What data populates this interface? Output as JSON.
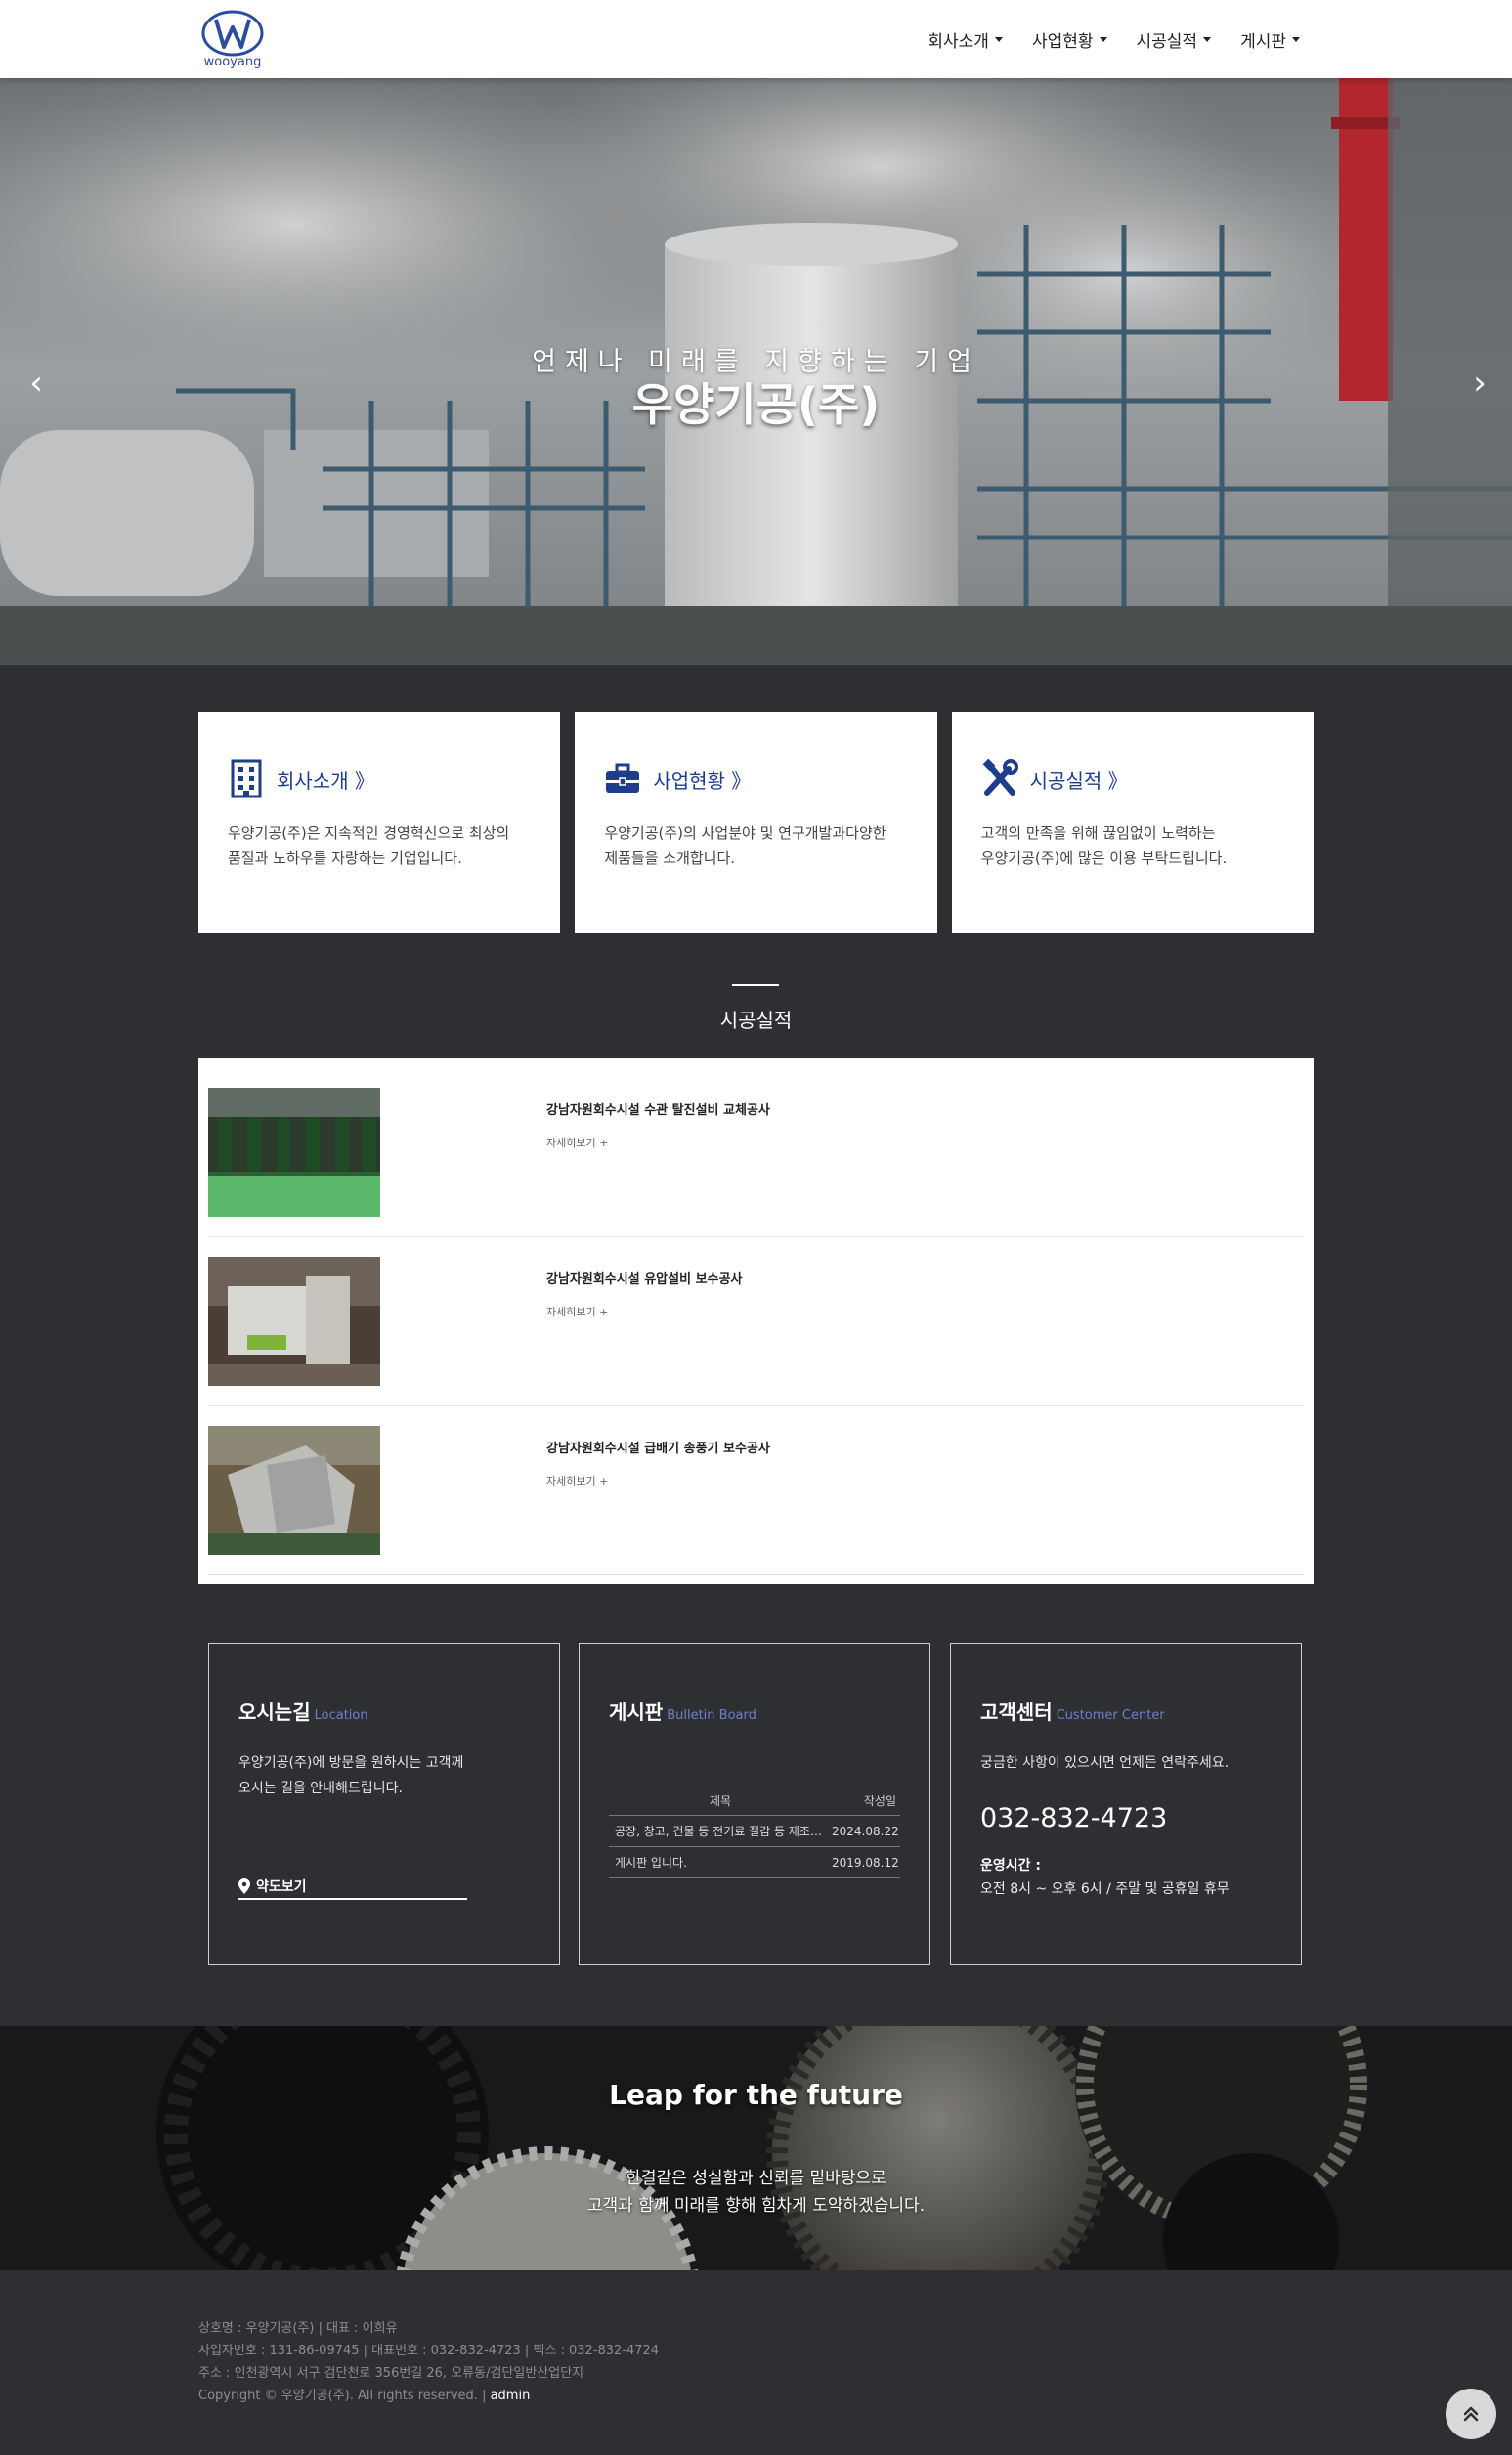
{
  "header": {
    "logo_text": "wooyang",
    "nav": [
      {
        "label": "회사소개"
      },
      {
        "label": "사업현황"
      },
      {
        "label": "시공실적"
      },
      {
        "label": "게시판"
      }
    ]
  },
  "hero": {
    "subtitle": "언제나 미래를 지향하는 기업",
    "title": "우양기공(주)",
    "prev": "‹",
    "next": "›"
  },
  "features": [
    {
      "icon": "building-icon",
      "title": "회사소개 》",
      "desc_lines": [
        "우양기공(주)은 지속적인 경영혁신으로 최상의",
        "품질과 노하우를 자랑하는 기업입니다."
      ]
    },
    {
      "icon": "briefcase-icon",
      "title": "사업현황 》",
      "desc_lines": [
        "우양기공(주)의 사업분야 및 연구개발과다양한",
        "제품들을 소개합니다."
      ]
    },
    {
      "icon": "tools-icon",
      "title": "시공실적 》",
      "desc_lines": [
        "고객의 만족을 위해 끊임없이 노력하는",
        "우양기공(주)에 많은 이용 부탁드립니다."
      ]
    }
  ],
  "works_section": {
    "title": "시공실적",
    "items": [
      {
        "title": "강남자원회수시설 수관 탈진설비 교체공사",
        "more": "자세히보기 +"
      },
      {
        "title": "강남자원회수시설 유압설비 보수공사",
        "more": "자세히보기 +"
      },
      {
        "title": "강남자원회수시설 급배기 송풍기 보수공사",
        "more": "자세히보기 +"
      }
    ]
  },
  "location": {
    "title": "오시는길",
    "title_en": "Location",
    "text_lines": [
      "우양기공(주)에 방문을 원하시는 고객께",
      "오시는 길을 안내해드립니다."
    ],
    "map_link": "약도보기"
  },
  "board": {
    "title": "게시판",
    "title_en": "Bulletin Board",
    "col_title": "제목",
    "col_date": "작성일",
    "rows": [
      {
        "title": "공장, 창고, 건물 등 전기료 절감 등 제조원가 절감",
        "date": "2024.08.22"
      },
      {
        "title": "게시판 입니다.",
        "date": "2019.08.12"
      }
    ]
  },
  "customer": {
    "title": "고객센터",
    "title_en": "Customer Center",
    "text": "궁금한 사항이 있으시면 언제든 연락주세요.",
    "phone": "032-832-4723",
    "hours_label": "운영시간 :",
    "hours": "오전 8시 ~ 오후 6시 / 주말 및 공휴일 휴무"
  },
  "banner": {
    "title": "Leap for the future",
    "lines": [
      "한결같은 성실함과 신뢰를 밑바탕으로",
      "고객과 함께 미래를 향해 힘차게 도약하겠습니다."
    ]
  },
  "footer": {
    "line1": "상호명 : 우양기공(주) | 대표 : 이희유",
    "line2": "사업자번호 : 131-86-09745 | 대표번호 : 032-832-4723 | 팩스 : 032-832-4724",
    "line3": "주소 : 인천광역시 서구 검단천로 356번길 26, 오류동/검단일반산업단지",
    "line4_prefix": "Copyright © 우양기공(주). All rights reserved. | ",
    "admin": "admin"
  },
  "colors": {
    "accent": "#1e3d8a",
    "background": "#2e2f33",
    "subtitle_en": "#6e7fc9"
  }
}
